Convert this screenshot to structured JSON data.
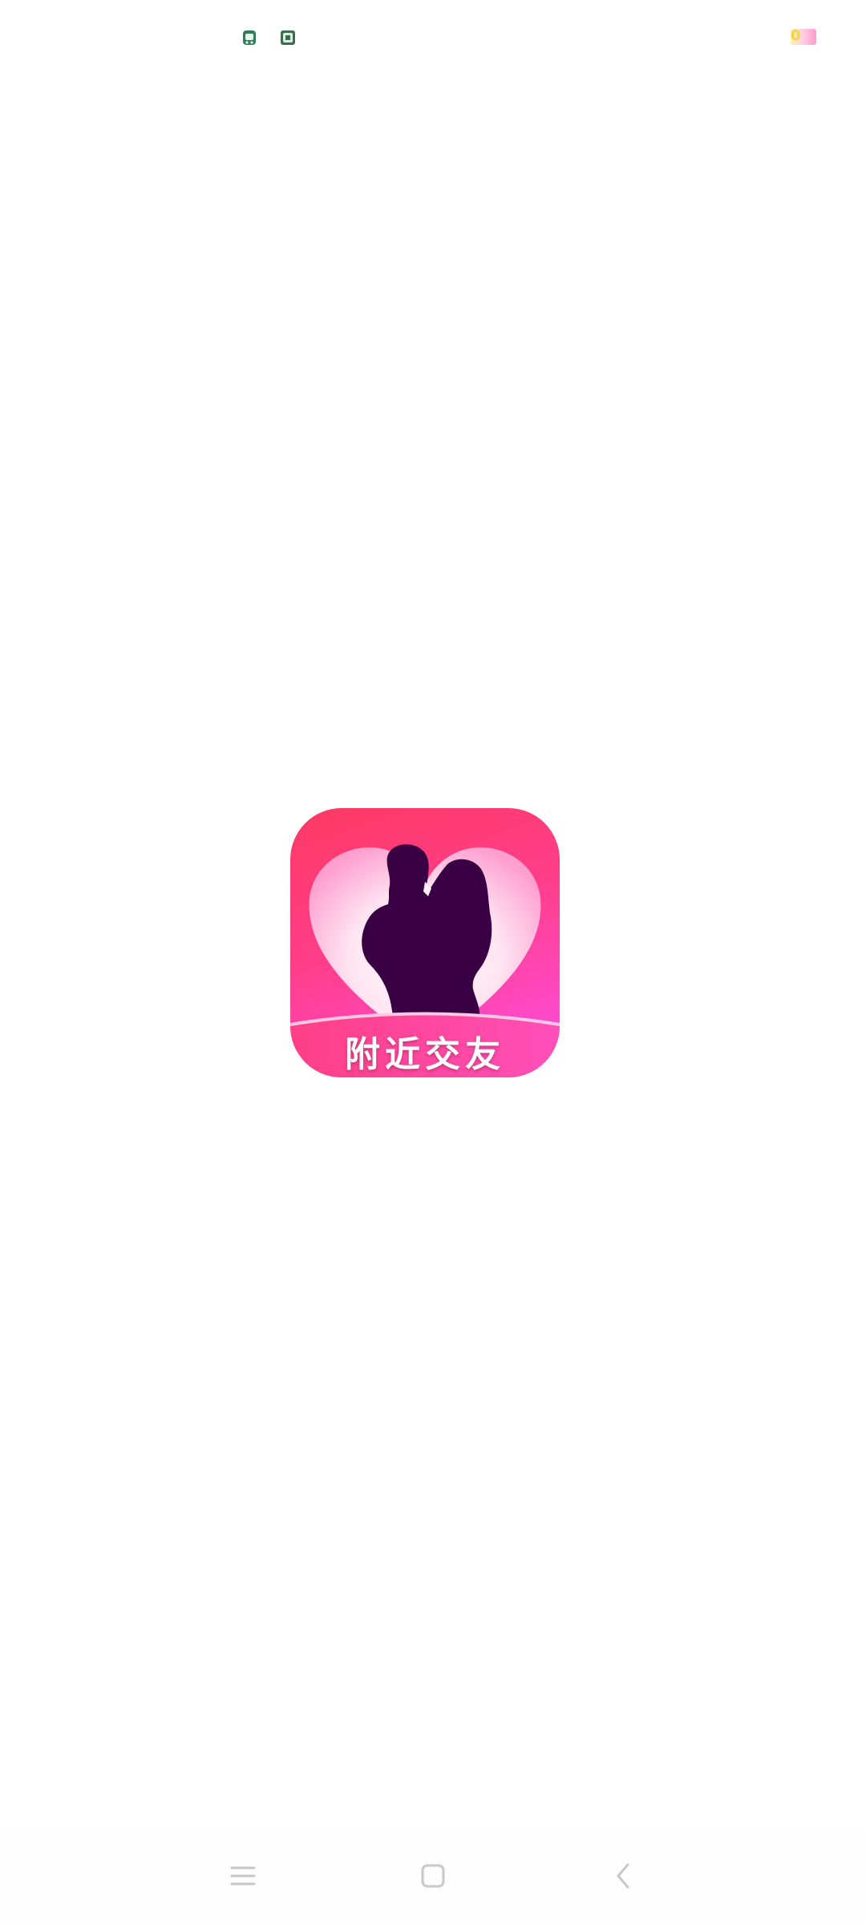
{
  "status_bar": {
    "icons": [
      "notification-app-icon",
      "notification-app-icon-2"
    ],
    "battery": {
      "value_text": "0",
      "colors": [
        "#fff3a6",
        "#ff9ccb"
      ]
    }
  },
  "splash": {
    "logo_icon": "couple-silhouette-heart-logo",
    "logo_caption": "附近交友",
    "colors": {
      "gradient_start": "#ff3a64",
      "gradient_end": "#f94de0",
      "silhouette": "#3a0044",
      "heart": "#ffe6f2"
    }
  },
  "nav_bar": {
    "buttons": [
      {
        "name": "menu",
        "icon": "menu-lines-icon"
      },
      {
        "name": "home",
        "icon": "home-square-icon"
      },
      {
        "name": "back",
        "icon": "back-chevron-icon"
      }
    ],
    "color": "#c8c8c8"
  }
}
